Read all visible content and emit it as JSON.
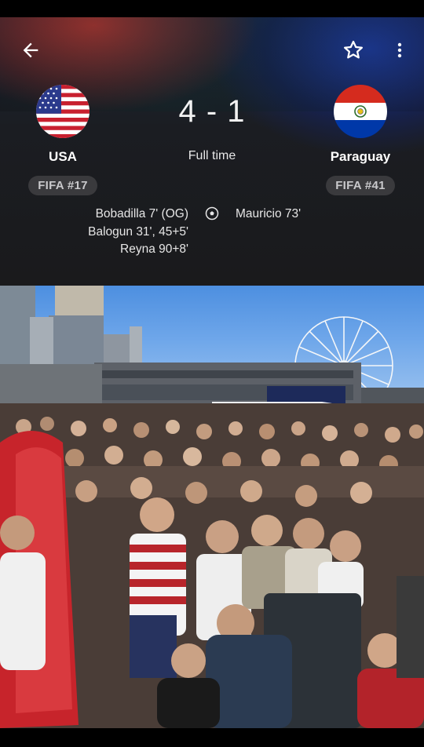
{
  "match": {
    "home_team": "USA",
    "away_team": "Paraguay",
    "score": "4 - 1",
    "status": "Full time",
    "home_rank": "FIFA #17",
    "away_rank": "FIFA #41"
  },
  "scorers": {
    "home": [
      "Bobadilla 7' (OG)",
      "Balogun 31', 45+5'",
      "Reyna 90+8'"
    ],
    "away": [
      "Mauricio 73'"
    ]
  },
  "icons": {
    "back": "arrow-left-icon",
    "favorite": "star-outline-icon",
    "more": "more-vert-icon",
    "goal": "soccer-ball-icon"
  },
  "colors": {
    "accent_red": "#b93732",
    "accent_blue": "#1e3ca0",
    "rank_chip_bg": "#3a3a3d"
  }
}
